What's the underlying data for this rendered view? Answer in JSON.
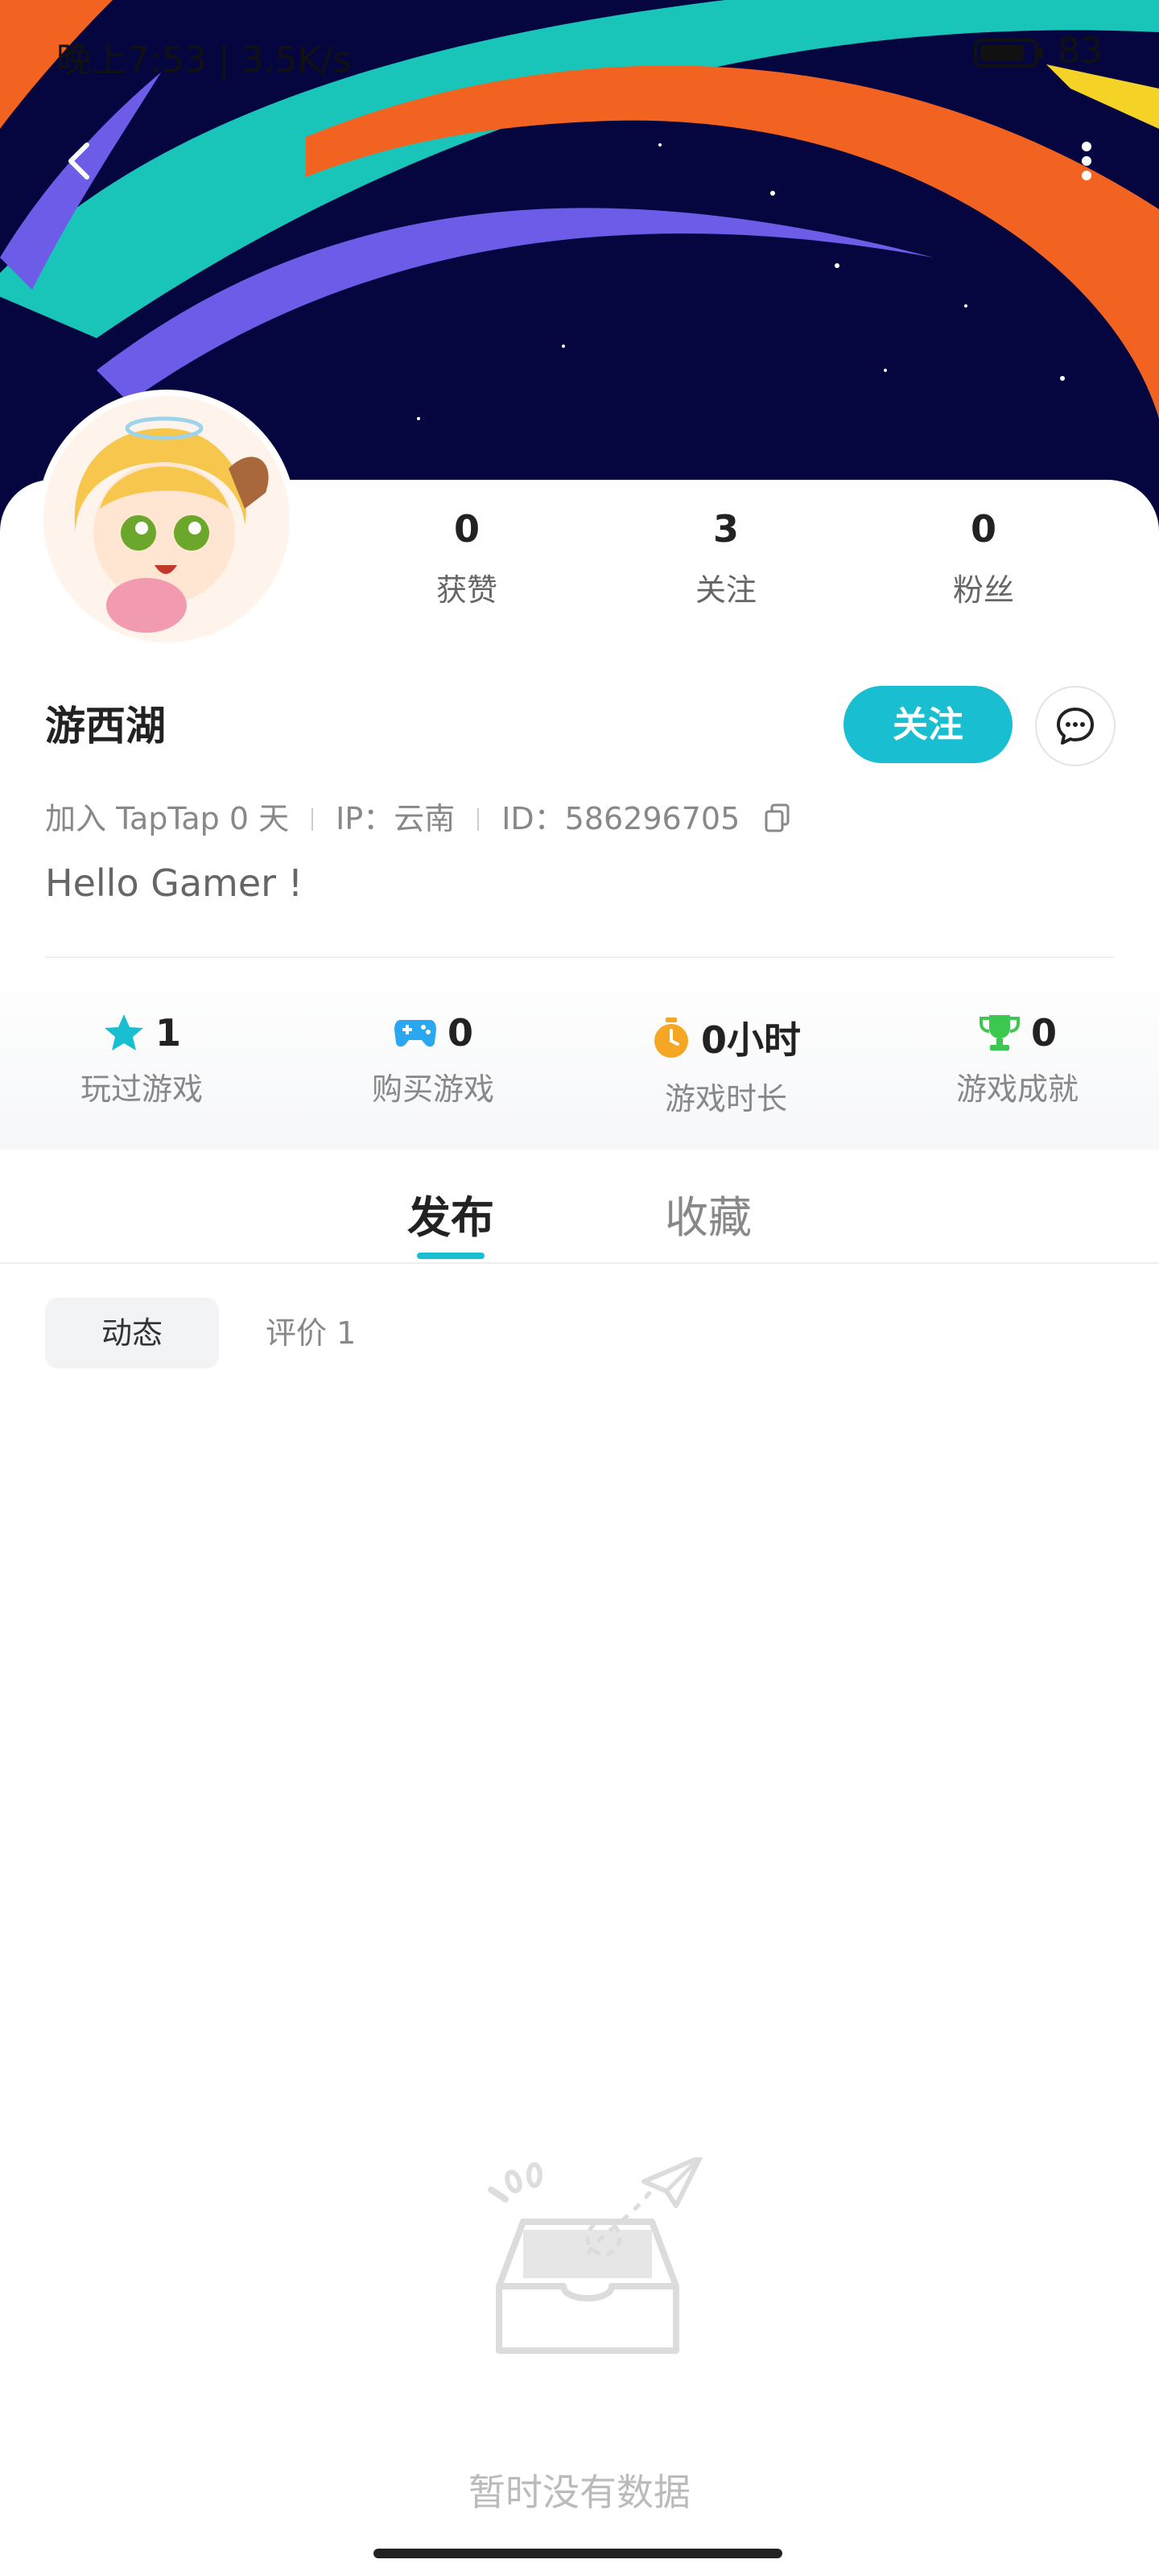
{
  "status_bar": {
    "time_speed": "晚上7:53 | 3.5K/s",
    "battery": "83"
  },
  "header": {
    "back_icon": "chevron-left-icon",
    "more_icon": "more-vertical-icon"
  },
  "profile": {
    "avatar": "anime-character-avatar",
    "stats": [
      {
        "value": "0",
        "label": "获赞"
      },
      {
        "value": "3",
        "label": "关注"
      },
      {
        "value": "0",
        "label": "粉丝"
      }
    ],
    "username": "游西湖",
    "follow_label": "关注",
    "message_icon": "chat-bubble-icon",
    "joined": "加入 TapTap 0 天",
    "ip": "IP：云南",
    "id": "ID：586296705",
    "bio": "Hello Gamer !"
  },
  "game_stats": [
    {
      "icon": "star-icon",
      "color": "#19bed0",
      "value": "1",
      "label": "玩过游戏"
    },
    {
      "icon": "gamepad-icon",
      "color": "#2aa7f0",
      "value": "0",
      "label": "购买游戏"
    },
    {
      "icon": "stopwatch-icon",
      "color": "#f5a623",
      "value": "0小时",
      "label": "游戏时长"
    },
    {
      "icon": "trophy-icon",
      "color": "#3cc751",
      "value": "0",
      "label": "游戏成就"
    }
  ],
  "tabs": [
    {
      "label": "发布",
      "active": true
    },
    {
      "label": "收藏",
      "active": false
    }
  ],
  "subtabs": [
    {
      "label": "动态",
      "active": true
    },
    {
      "label": "评价 1",
      "active": false
    }
  ],
  "empty_state": {
    "text": "暂时没有数据",
    "icon": "empty-inbox-icon"
  },
  "colors": {
    "accent": "#19bed0"
  }
}
